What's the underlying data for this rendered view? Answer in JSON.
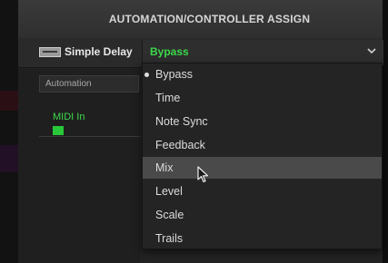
{
  "header": {
    "title": "AUTOMATION/CONTROLLER ASSIGN"
  },
  "block": {
    "name": "Simple Delay",
    "icon": "delay-block-icon"
  },
  "parameter": {
    "selected": "Bypass",
    "icon": "chevron-down-icon"
  },
  "automation": {
    "label": "Automation"
  },
  "midi": {
    "label": "MIDI In"
  },
  "menu": {
    "items": [
      {
        "label": "Bypass",
        "selected": true
      },
      {
        "label": "Time"
      },
      {
        "label": "Note Sync"
      },
      {
        "label": "Feedback"
      },
      {
        "label": "Mix",
        "hovered": true
      },
      {
        "label": "Level"
      },
      {
        "label": "Scale"
      },
      {
        "label": "Trails"
      }
    ]
  },
  "colors": {
    "accent_green": "#3cd84a",
    "menu_bg": "#242424",
    "hover_bg": "#4a4a4a",
    "header_bg": "#353535"
  }
}
